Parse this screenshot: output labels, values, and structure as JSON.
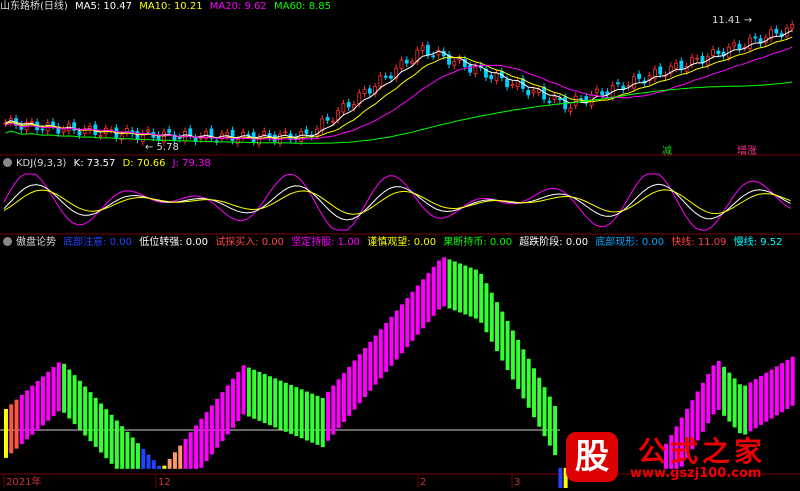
{
  "chart_data": [
    {
      "type": "candlestick",
      "title": "山东路桥(日线)",
      "indicators": [
        {
          "label": "MA5: 10.47",
          "color": "#ffffff"
        },
        {
          "label": "MA10: 10.21",
          "color": "#ffff00"
        },
        {
          "label": "MA20: 9.62",
          "color": "#ff00ff"
        },
        {
          "label": "MA60: 8.85",
          "color": "#00ff00"
        }
      ],
      "annotations": [
        "11.41",
        "5.78"
      ],
      "tags": [
        {
          "text": "减",
          "color": "#22cc22"
        },
        {
          "text": "增涨",
          "color": "#ff3399"
        }
      ]
    },
    {
      "type": "line",
      "title": "KDJ(9,3,3)",
      "series": [
        {
          "name": "K",
          "label": "K: 73.57",
          "color": "#ffffff"
        },
        {
          "name": "D",
          "label": "D: 70.66",
          "color": "#ffff00"
        },
        {
          "name": "J",
          "label": "J: 79.38",
          "color": "#ff00ff"
        }
      ]
    },
    {
      "type": "bar",
      "title": "傲盘论势",
      "legend": [
        {
          "label": "底部注意: 0.00",
          "color": "#0000ff"
        },
        {
          "label": "低位转强: 0.00",
          "color": "#ffffff"
        },
        {
          "label": "试探买入: 0.00",
          "color": "#ff4444"
        },
        {
          "label": "坚定持股: 1.00",
          "color": "#ff00ff"
        },
        {
          "label": "谨慎观望: 0.00",
          "color": "#ffff00"
        },
        {
          "label": "果断持币: 0.00",
          "color": "#00ff00"
        },
        {
          "label": "超跌阶段: 0.00",
          "color": "#ffffff"
        },
        {
          "label": "底部现形: 0.00",
          "color": "#00aaff"
        },
        {
          "label": "快线: 11.09",
          "color": "#ff4444"
        },
        {
          "label": "慢线: 9.52",
          "color": "#00ffff"
        }
      ],
      "x_ticks": [
        "2021年",
        "12",
        "2",
        "3"
      ]
    }
  ],
  "watermark": {
    "logo": "股",
    "title": "公式之家",
    "url": "www.gszj100.com"
  }
}
